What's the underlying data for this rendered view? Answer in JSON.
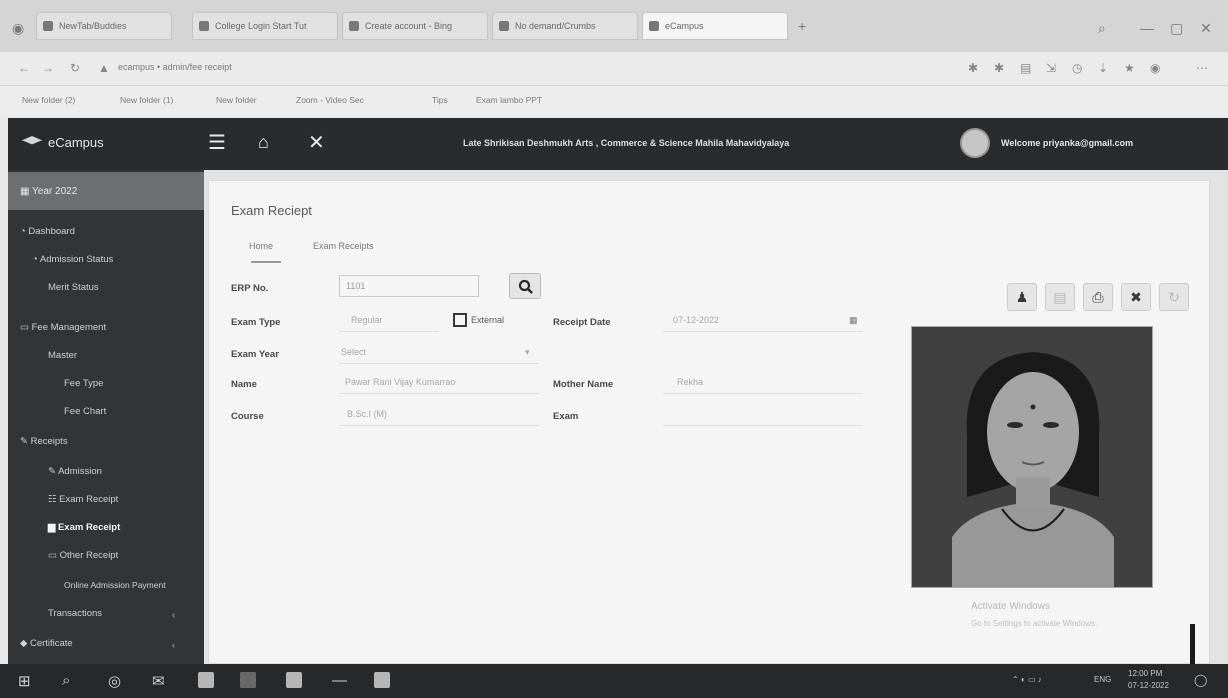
{
  "browser": {
    "tabs": [
      {
        "label": "NewTab/Buddies"
      },
      {
        "label": "College Login Start Tut"
      },
      {
        "label": "Create account - Bing"
      },
      {
        "label": "No demand/Crumbs"
      },
      {
        "label": "eCampus"
      }
    ],
    "address": "ecampus • admin/fee receipt",
    "bookmarks": [
      "New folder (2)",
      "New folder (1)",
      "New folder",
      "Zoom - Video Sec",
      "Tips",
      "Exam lambo PPT"
    ]
  },
  "header": {
    "brand": "eCampus",
    "college": "Late Shrikisan Deshmukh Arts , Commerce & Science Mahila Mahavidyalaya",
    "welcome": "Welcome priyanka@gmail.com"
  },
  "sidebar": {
    "year": "Year 2022",
    "items": [
      {
        "label": "Dashboard"
      },
      {
        "label": "Admission Status"
      },
      {
        "label": "Merit Status"
      },
      {
        "label": "Fee Management"
      },
      {
        "label": "Master"
      },
      {
        "label": "Fee Type"
      },
      {
        "label": "Fee Chart"
      },
      {
        "label": "Receipts"
      },
      {
        "label": "Admission"
      },
      {
        "label": "Exam Receipt"
      },
      {
        "label": "Exam Receipt"
      },
      {
        "label": "Other Receipt"
      },
      {
        "label": "Online Admission Payment"
      },
      {
        "label": "Transactions"
      },
      {
        "label": "Certificate"
      }
    ]
  },
  "page": {
    "title": "Exam Reciept",
    "tabs": [
      "Home",
      "Exam Receipts"
    ],
    "fields": {
      "erp_label": "ERP No.",
      "erp_value": "1101",
      "exam_type_label": "Exam Type",
      "exam_type_value": "Regular",
      "external_label": "External",
      "receipt_date_label": "Receipt Date",
      "receipt_date_value": "07-12-2022",
      "exam_year_label": "Exam Year",
      "exam_year_value": "Select",
      "name_label": "Name",
      "name_value": "Pawar Rani Vijay Kumarrao",
      "mother_label": "Mother Name",
      "mother_value": "Rekha",
      "course_label": "Course",
      "course_value": "B.Sc.I (M)",
      "exam_label": "Exam"
    },
    "watermark_title": "Activate Windows",
    "watermark_sub": "Go to Settings to activate Windows."
  },
  "taskbar": {
    "lang": "ENG",
    "time": "12:00 PM",
    "date": "07-12-2022"
  }
}
